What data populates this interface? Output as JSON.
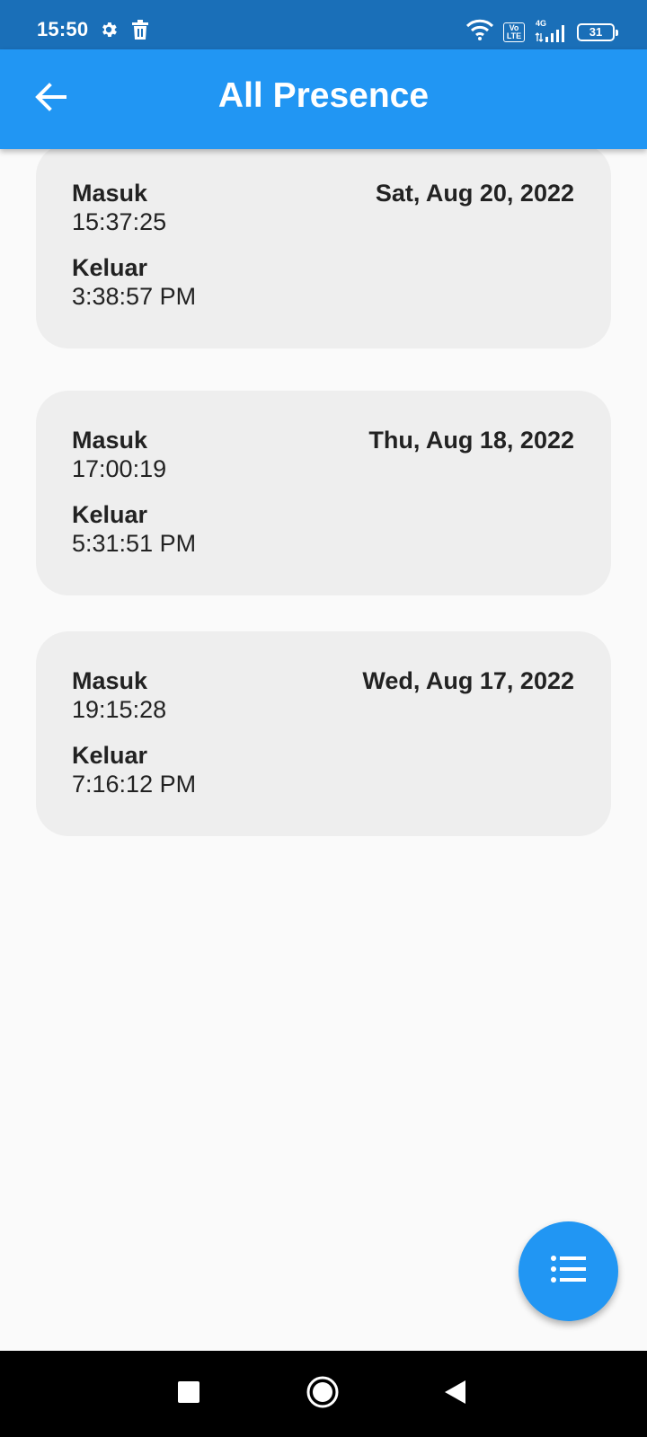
{
  "status_bar": {
    "time": "15:50",
    "volte_label": "Vo LTE",
    "network_label": "4G",
    "battery_level": "31"
  },
  "app_bar": {
    "title": "All Presence"
  },
  "presence_list": [
    {
      "in_label": "Masuk",
      "in_time": "15:37:25",
      "date": "Sat, Aug 20, 2022",
      "out_label": "Keluar",
      "out_time": "3:38:57 PM"
    },
    {
      "in_label": "Masuk",
      "in_time": "17:00:19",
      "date": "Thu, Aug 18, 2022",
      "out_label": "Keluar",
      "out_time": "5:31:51 PM"
    },
    {
      "in_label": "Masuk",
      "in_time": "19:15:28",
      "date": "Wed, Aug 17, 2022",
      "out_label": "Keluar",
      "out_time": "7:16:12 PM"
    }
  ],
  "colors": {
    "primary": "#2196f3",
    "status_bar": "#1a6fb8",
    "card_background": "#eeeeee",
    "page_background": "#fafafa"
  }
}
